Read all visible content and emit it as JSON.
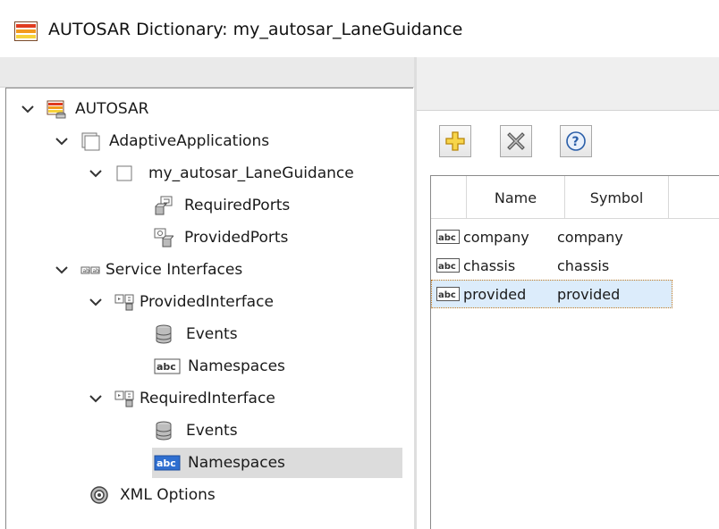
{
  "window": {
    "title": "AUTOSAR Dictionary: my_autosar_LaneGuidance"
  },
  "tree": {
    "items": [
      {
        "label": "AUTOSAR",
        "icon": "autosar-root-icon"
      },
      {
        "label": "AdaptiveApplications",
        "icon": "folder-icon"
      },
      {
        "label": "my_autosar_LaneGuidance",
        "icon": "component-icon"
      },
      {
        "label": "RequiredPorts",
        "icon": "required-ports-icon"
      },
      {
        "label": "ProvidedPorts",
        "icon": "provided-ports-icon"
      },
      {
        "label": "Service Interfaces",
        "icon": "service-interfaces-icon"
      },
      {
        "label": "ProvidedInterface",
        "icon": "interface-icon"
      },
      {
        "label": "Events",
        "icon": "events-database-icon"
      },
      {
        "label": "Namespaces",
        "icon": "abc-icon"
      },
      {
        "label": "RequiredInterface",
        "icon": "interface-icon"
      },
      {
        "label": "Events",
        "icon": "events-database-icon"
      },
      {
        "label": "Namespaces",
        "icon": "abc-icon"
      },
      {
        "label": "XML Options",
        "icon": "gear-icon"
      }
    ],
    "selected": "Namespaces"
  },
  "toolbar": {
    "add": "add-icon",
    "delete": "delete-icon",
    "help": "help-icon"
  },
  "table": {
    "columns": [
      "Name",
      "Symbol"
    ],
    "rows": [
      {
        "name": "company",
        "symbol": "company"
      },
      {
        "name": "chassis",
        "symbol": "chassis"
      },
      {
        "name": "provided",
        "symbol": "provided"
      }
    ],
    "selected_row": "provided"
  }
}
